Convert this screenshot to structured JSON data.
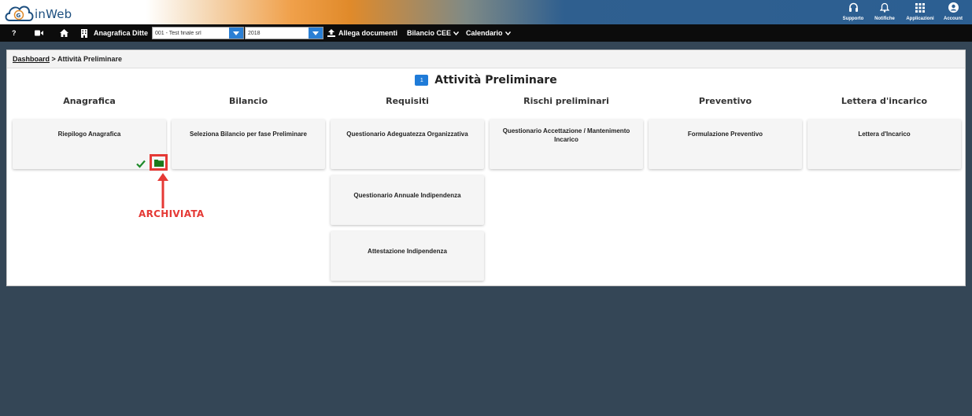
{
  "header": {
    "logo_text": "inWeb",
    "actions": [
      {
        "label": "Supporto",
        "icon": "headset-icon"
      },
      {
        "label": "Notifiche",
        "icon": "bell-icon"
      },
      {
        "label": "Applicazioni",
        "icon": "apps-grid-icon"
      },
      {
        "label": "Account",
        "icon": "account-icon"
      }
    ]
  },
  "toolbar": {
    "help": "?",
    "anagrafica_label": "Anagrafica Ditte",
    "company_select": "001 - Test finale srl",
    "year_select": "2018",
    "allega_label": "Allega documenti",
    "bilancio_label": "Bilancio CEE",
    "calendario_label": "Calendario"
  },
  "breadcrumb": {
    "dashboard": "Dashboard",
    "separator": ">",
    "current": "Attività Preliminare"
  },
  "page": {
    "step_number": "1",
    "title": "Attività Preliminare"
  },
  "columns": [
    {
      "heading": "Anagrafica",
      "cards": [
        {
          "label": "Riepilogo Anagrafica",
          "archived": true
        }
      ]
    },
    {
      "heading": "Bilancio",
      "cards": [
        {
          "label": "Seleziona Bilancio per fase Preliminare"
        }
      ]
    },
    {
      "heading": "Requisiti",
      "cards": [
        {
          "label": "Questionario Adeguatezza Organizzativa"
        },
        {
          "label": "Questionario Annuale Indipendenza"
        },
        {
          "label": "Attestazione Indipendenza"
        }
      ]
    },
    {
      "heading": "Rischi preliminari",
      "cards": [
        {
          "label": "Questionario Accettazione / Mantenimento Incarico"
        }
      ]
    },
    {
      "heading": "Preventivo",
      "cards": [
        {
          "label": "Formulazione Preventivo"
        }
      ]
    },
    {
      "heading": "Lettera d'incarico",
      "cards": [
        {
          "label": "Lettera d'Incarico"
        }
      ]
    }
  ],
  "annotation": {
    "text": "ARCHIVIATA",
    "color": "#e53935"
  },
  "colors": {
    "accent": "#1f7bd8",
    "success": "#1f8a2a",
    "folder": "#1c7a1c",
    "annotation": "#e53935"
  }
}
